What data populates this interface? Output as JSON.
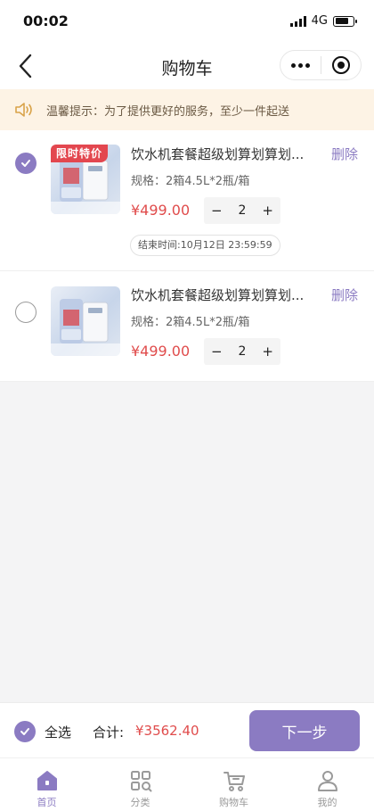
{
  "status_bar": {
    "time": "00:02",
    "network": "4G",
    "battery_level": 0.8
  },
  "nav": {
    "title": "购物车"
  },
  "notice": {
    "text": "温馨提示：为了提供更好的服务，至少一件起送"
  },
  "cart": {
    "items": [
      {
        "checked": true,
        "promo_tag": "限时特价",
        "title": "饮水机套餐超级划算划算划...",
        "delete_label": "删除",
        "spec": "规格：2箱4.5L*2瓶/箱",
        "price": "¥499.00",
        "qty": "2",
        "minus": "−",
        "plus": "+",
        "countdown": "结束时间:10月12日 23:59:59"
      },
      {
        "checked": false,
        "title": "饮水机套餐超级划算划算划...",
        "delete_label": "删除",
        "spec": "规格：2箱4.5L*2瓶/箱",
        "price": "¥499.00",
        "qty": "2",
        "minus": "−",
        "plus": "+"
      }
    ]
  },
  "checkout": {
    "select_all_label": "全选",
    "total_label": "合计:",
    "total_value": "¥3562.40",
    "next_label": "下一步"
  },
  "tabs": [
    {
      "label": "首页",
      "icon": "home-icon",
      "active": true
    },
    {
      "label": "分类",
      "icon": "category-icon",
      "active": false
    },
    {
      "label": "购物车",
      "icon": "cart-icon",
      "active": false
    },
    {
      "label": "我的",
      "icon": "profile-icon",
      "active": false
    }
  ],
  "colors": {
    "accent": "#8b7bc2",
    "price": "#e04c4c",
    "promo": "#e3474f",
    "notice_bg": "#fdf3e5"
  }
}
